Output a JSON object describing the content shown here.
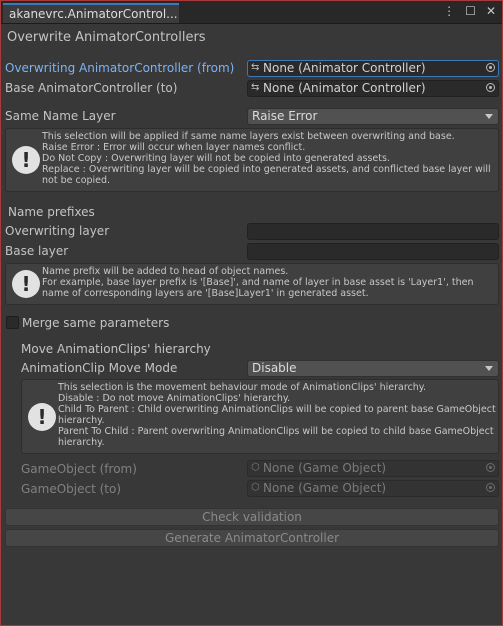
{
  "window": {
    "tab_title": "akanevrc.AnimatorControl...",
    "menu_icon": "kebab-menu-icon",
    "maximize_icon": "maximize-icon",
    "close_icon": "close-icon"
  },
  "header": {
    "title": "Overwrite AnimatorControllers"
  },
  "controllers": {
    "from_label": "Overwriting AnimatorController (from)",
    "from_value": "None (Animator Controller)",
    "to_label": "Base AnimatorController (to)",
    "to_value": "None (Animator Controller)"
  },
  "same_name_layer": {
    "label": "Same Name Layer",
    "selected": "Raise Error",
    "help": [
      "This selection will be applied if same name layers exist between overwriting and base.",
      "Raise Error : Error will occur when layer names conflict.",
      "Do Not Copy : Overwriting layer will not be copied into generated assets.",
      "Replace : Overwriting layer will be copied into generated assets, and conflicted base layer will",
      "not be copied."
    ]
  },
  "prefixes": {
    "heading": "Name prefixes",
    "overwriting_label": "Overwriting layer",
    "overwriting_value": "",
    "base_label": "Base layer",
    "base_value": "",
    "help": [
      "Name prefix will be added to head of object names.",
      "For example, base layer prefix is '[Base]', and name of layer in base asset is 'Layer1', then",
      "name of corresponding layers are '[Base]Layer1' in generated asset."
    ]
  },
  "merge": {
    "label": "Merge same parameters",
    "checked": false
  },
  "hierarchy": {
    "heading": "Move AnimationClips' hierarchy",
    "mode_label": "AnimationClip Move Mode",
    "mode_selected": "Disable",
    "help": [
      "This selection is the movement behaviour mode of AnimationClips' hierarchy.",
      "Disable : Do not move AnimationClips' hierarchy.",
      "Child To Parent : Child overwriting AnimationClips will be copied to parent base GameObject",
      "hierarchy.",
      "Parent To Child : Parent overwriting AnimationClips will be copied to child base GameObject",
      "hierarchy."
    ],
    "go_from_label": "GameObject (from)",
    "go_from_value": "None (Game Object)",
    "go_to_label": "GameObject (to)",
    "go_to_value": "None (Game Object)"
  },
  "buttons": {
    "validate": "Check validation",
    "generate": "Generate AnimatorController"
  }
}
